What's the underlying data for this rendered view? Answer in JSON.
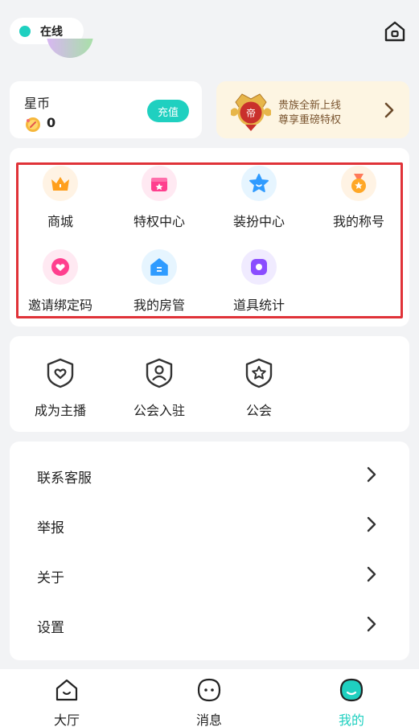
{
  "status": {
    "label": "在线",
    "color": "#1fd0c0"
  },
  "coins": {
    "label": "星币",
    "count": "0",
    "recharge_label": "充值"
  },
  "vip": {
    "line1": "贵族全新上线",
    "line2": "尊享重磅特权"
  },
  "features": [
    {
      "label": "商城",
      "icon": "crown-icon"
    },
    {
      "label": "特权中心",
      "icon": "gift-icon"
    },
    {
      "label": "装扮中心",
      "icon": "star-icon"
    },
    {
      "label": "我的称号",
      "icon": "medal-icon"
    },
    {
      "label": "邀请绑定码",
      "icon": "heart-icon"
    },
    {
      "label": "我的房管",
      "icon": "house-icon"
    },
    {
      "label": "道具统计",
      "icon": "prop-icon"
    }
  ],
  "guild": [
    {
      "label": "成为主播",
      "icon": "heart-shield-icon"
    },
    {
      "label": "公会入驻",
      "icon": "user-shield-icon"
    },
    {
      "label": "公会",
      "icon": "star-shield-icon"
    }
  ],
  "menu": [
    {
      "label": "联系客服"
    },
    {
      "label": "举报"
    },
    {
      "label": "关于"
    },
    {
      "label": "设置"
    }
  ],
  "tabs": [
    {
      "label": "大厅",
      "icon": "hall-icon"
    },
    {
      "label": "消息",
      "icon": "message-icon"
    },
    {
      "label": "我的",
      "icon": "profile-icon",
      "active": true
    }
  ],
  "colors": {
    "accent": "#1fd0c0",
    "highlight_frame": "#e03238"
  }
}
